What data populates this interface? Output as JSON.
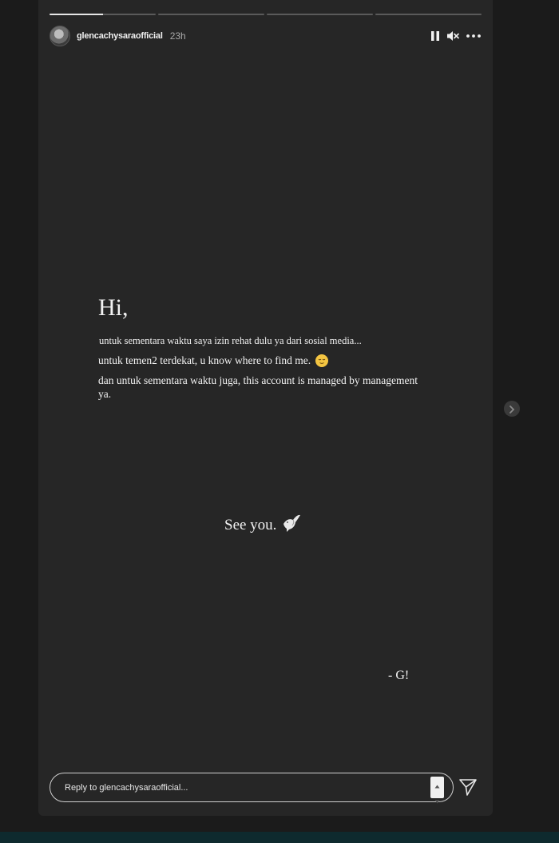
{
  "story": {
    "progress_segments": [
      0.5,
      0,
      0,
      0
    ],
    "username": "glencachysaraofficial",
    "timestamp": "23h",
    "icons": [
      "pause-icon",
      "mute-icon",
      "more-options-icon"
    ]
  },
  "content": {
    "greeting": "Hi,",
    "line1": "untuk sementara waktu saya izin rehat dulu ya dari sosial media...",
    "line2": "untuk temen2 terdekat, u know where to find me.",
    "line3": "dan untuk sementara waktu juga, this account is managed by management ya.",
    "farewell": "See you.",
    "signature": "- G!"
  },
  "reply": {
    "placeholder": "Reply to glencachysaraofficial..."
  },
  "colors": {
    "story_bg": "#262626",
    "page_bg": "#1b1b1b",
    "text": "#f2f2f2"
  }
}
